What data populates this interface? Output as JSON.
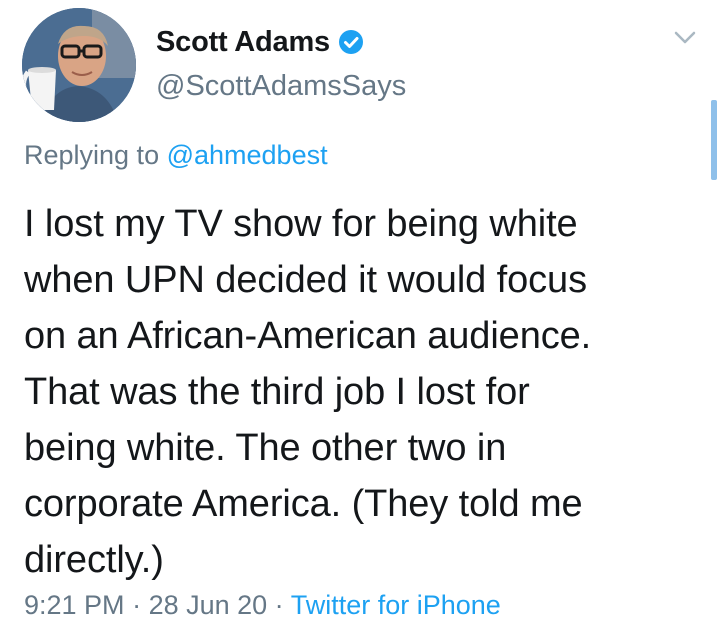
{
  "author": {
    "name": "Scott Adams",
    "handle": "@ScottAdamsSays",
    "verified": true
  },
  "reply": {
    "prefix": "Replying to ",
    "mention": "@ahmedbest"
  },
  "tweet": {
    "lines": [
      "I lost my TV show for being white",
      "when UPN decided it would focus",
      "on an African-American audience.",
      "That was the third job I lost for",
      "being white. The other two in",
      "corporate America. (They told me",
      "directly.)"
    ]
  },
  "meta": {
    "time": "9:21 PM",
    "separator1": " · ",
    "date": "28 Jun 20",
    "separator2": " · ",
    "source": "Twitter for iPhone"
  },
  "icons": {
    "verified": "verified-badge-icon",
    "menu": "chevron-down-icon"
  },
  "colors": {
    "link": "#1da1f2",
    "secondary_text": "#657786",
    "primary_text": "#14171a"
  }
}
